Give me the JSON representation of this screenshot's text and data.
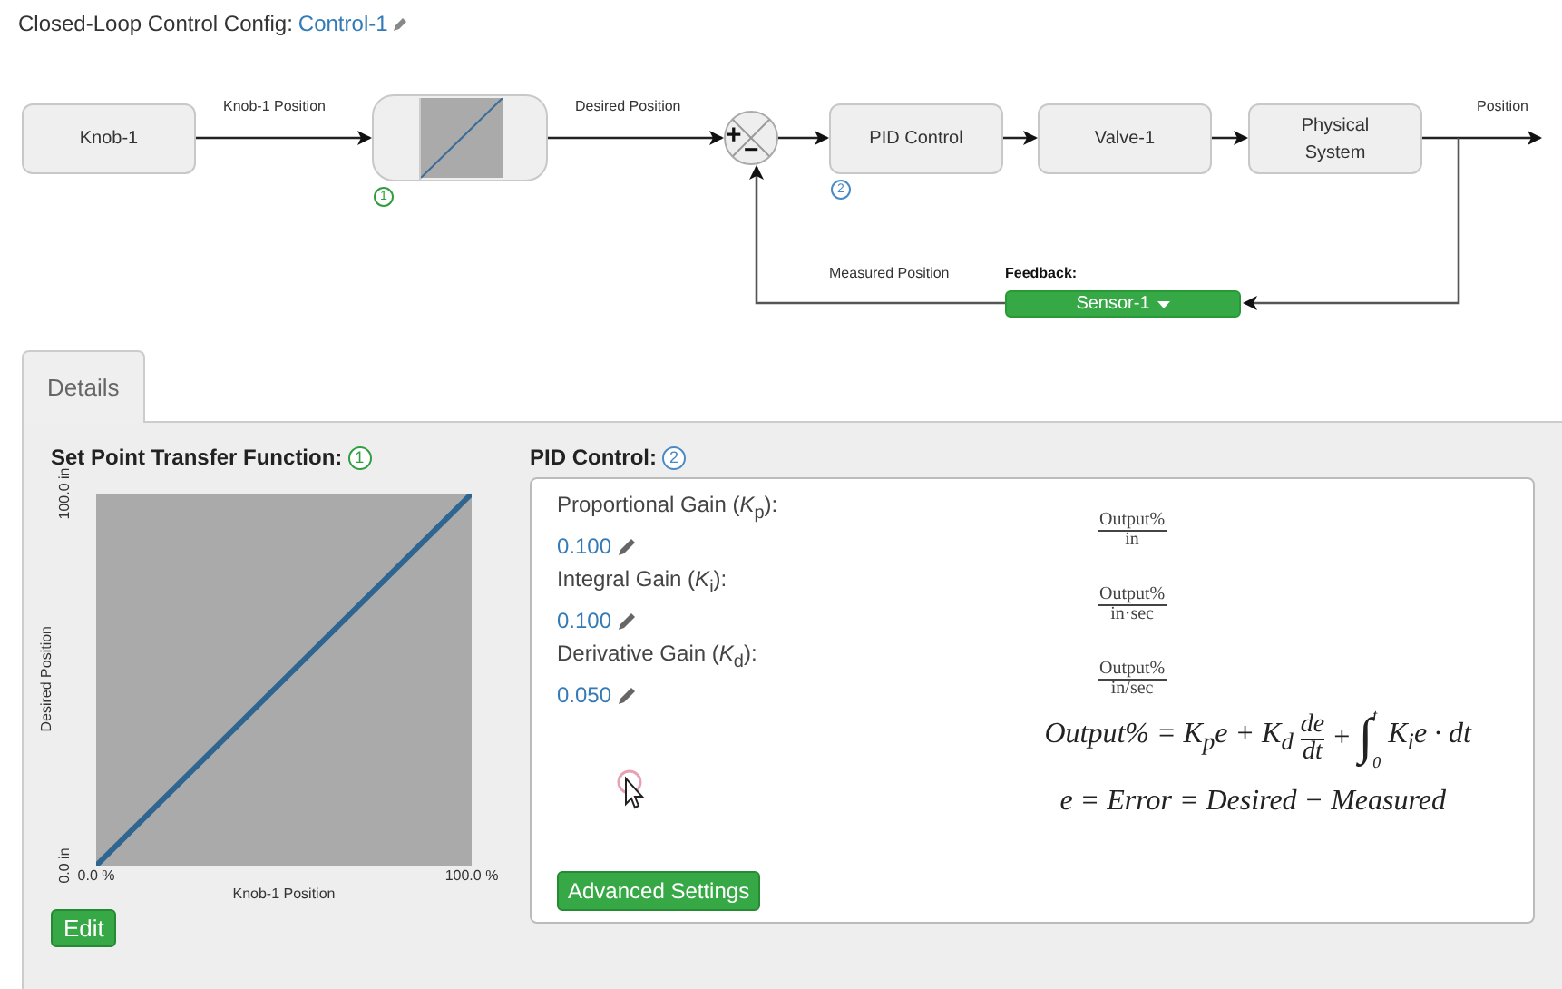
{
  "header": {
    "label": "Closed-Loop Control Config:",
    "name": "Control-1"
  },
  "diagram": {
    "blocks": [
      {
        "kind": "block",
        "label": "Knob-1"
      },
      {
        "kind": "plot",
        "badge": "1"
      },
      {
        "kind": "sum",
        "plus": "+",
        "minus": "−"
      },
      {
        "kind": "block",
        "label": "PID Control",
        "badge": "2"
      },
      {
        "kind": "block",
        "label": "Valve-1"
      },
      {
        "kind": "block",
        "label": "Physical System"
      }
    ],
    "signals": [
      "Knob-1 Position",
      "Desired Position",
      "Position",
      "Measured Position"
    ],
    "feedback": {
      "label": "Feedback:",
      "sensor": "Sensor-1"
    }
  },
  "tabs": [
    {
      "label": "Details",
      "selected": true
    }
  ],
  "transfer": {
    "title": "Set Point Transfer Function:",
    "badge": "1",
    "chart_data": {
      "type": "line",
      "xlabel": "Knob-1 Position",
      "ylabel": "Desired Position",
      "x": [
        0,
        100
      ],
      "values": [
        0,
        100
      ],
      "xlim": [
        0,
        100
      ],
      "ylim": [
        0,
        100
      ],
      "xticks": [
        {
          "value": 0,
          "label": "0.0 %"
        },
        {
          "value": 100,
          "label": "100.0 %"
        }
      ],
      "yticks": [
        {
          "value": 0,
          "label": "0.0 in"
        },
        {
          "value": 100,
          "label": "100.0 in"
        }
      ]
    },
    "button": "Edit"
  },
  "pid": {
    "title": "PID Control:",
    "badge": "2",
    "gains": [
      {
        "label": "Proportional Gain (*K*$_{p}$):",
        "value": "0.100",
        "numerator": "Output%",
        "denominator": "in"
      },
      {
        "label": "Integral Gain (*K*$_{i}$):",
        "value": "0.100",
        "numerator": "Output%",
        "denominator": "in·sec"
      },
      {
        "label": "Derivative Gain (*K*$_{d}$):",
        "value": "0.050",
        "numerator": "Output%",
        "denominator": "in/sec"
      }
    ],
    "formula": [
      {
        "kind": "text",
        "text": "Output% = K$_{p}$e + K$_{d}$"
      },
      {
        "kind": "fraction",
        "numerator": "de",
        "denominator": "dt"
      },
      {
        "kind": "text",
        "text": "+"
      },
      {
        "kind": "integral",
        "symbol": "∫",
        "upper": "t",
        "lower": "0"
      },
      {
        "kind": "text",
        "text": "K$_{i}$e · dt"
      }
    ],
    "error": "e = Error = Desired − Measured",
    "button": "Advanced Settings"
  }
}
